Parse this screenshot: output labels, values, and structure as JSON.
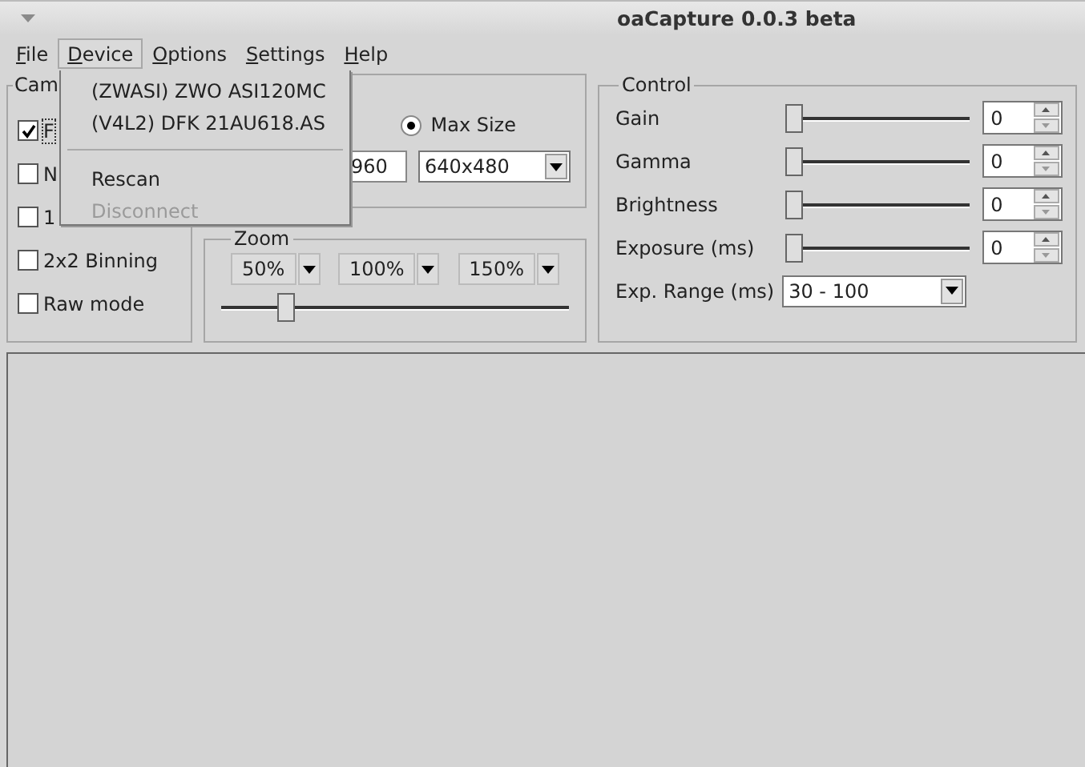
{
  "window": {
    "title": "oaCapture 0.0.3 beta"
  },
  "menu_bar": [
    {
      "label": "File",
      "selected": false
    },
    {
      "label": "Device",
      "selected": true
    },
    {
      "label": "Options",
      "selected": false
    },
    {
      "label": "Settings",
      "selected": false
    },
    {
      "label": "Help",
      "selected": false
    }
  ],
  "device_menu": [
    {
      "kind": "item",
      "label": "(ZWASI) ZWO ASI120MC",
      "disabled": false
    },
    {
      "kind": "item",
      "label": "(V4L2) DFK 21AU618.AS",
      "disabled": false
    },
    {
      "kind": "separator"
    },
    {
      "kind": "item",
      "label": "Rescan",
      "disabled": false
    },
    {
      "kind": "item",
      "label": "Disconnect",
      "disabled": true
    }
  ],
  "camera": {
    "title": "Cam",
    "options": [
      {
        "label": "F",
        "checked": true,
        "focused": true
      },
      {
        "label": "N",
        "checked": false,
        "focused": false
      },
      {
        "label": "1",
        "checked": false,
        "focused": false
      },
      {
        "label": "2x2 Binning",
        "checked": false,
        "focused": false
      },
      {
        "label": "Raw mode",
        "checked": false,
        "focused": false
      }
    ]
  },
  "resolution": {
    "max_size": {
      "label": "Max Size",
      "selected": true
    },
    "width_field": "960",
    "size_combo": "640x480"
  },
  "zoom": {
    "title": "Zoom",
    "buttons": [
      "50%",
      "100%",
      "150%"
    ],
    "slider": {
      "level": 0.17
    }
  },
  "control": {
    "title": "Control",
    "rows": [
      {
        "kind": "slider",
        "label": "Gain",
        "level": 0,
        "value": "0"
      },
      {
        "kind": "slider",
        "label": "Gamma",
        "level": 0,
        "value": "0"
      },
      {
        "kind": "slider",
        "label": "Brightness",
        "level": 0,
        "value": "0"
      },
      {
        "kind": "slider",
        "label": "Exposure (ms)",
        "level": 0,
        "value": "0"
      },
      {
        "kind": "combo",
        "label": "Exp. Range (ms)",
        "value": "30 - 100"
      }
    ]
  }
}
